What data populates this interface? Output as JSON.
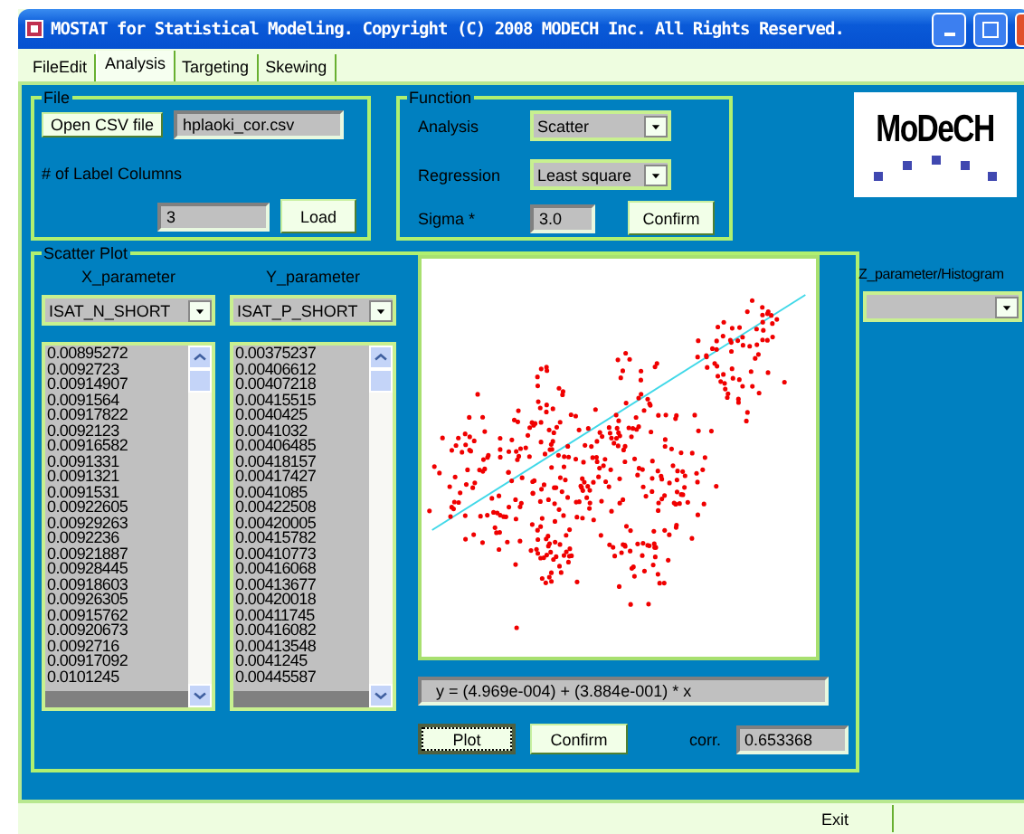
{
  "window": {
    "title": "MOSTAT for Statistical Modeling. Copyright (C) 2008 MODECH Inc. All Rights Reserved."
  },
  "tabs": [
    {
      "label": "FileEdit",
      "selected": false
    },
    {
      "label": "Analysis",
      "selected": true
    },
    {
      "label": "Targeting",
      "selected": false
    },
    {
      "label": "Skewing",
      "selected": false
    }
  ],
  "file": {
    "legend": "File",
    "open_button": "Open CSV file",
    "filename": "hplaoki_cor.csv",
    "label_columns_label": "# of Label Columns",
    "label_columns": "3",
    "load_button": "Load"
  },
  "function": {
    "legend": "Function",
    "rows": [
      {
        "label": "Analysis",
        "value": "Scatter"
      },
      {
        "label": "Regression",
        "value": "Least square"
      }
    ],
    "sigma_label": "Sigma *",
    "sigma": "3.0",
    "confirm_button": "Confirm"
  },
  "logo": {
    "text": "MoDeCH"
  },
  "scatter": {
    "legend": "Scatter Plot",
    "x_label": "X_parameter",
    "x_value": "ISAT_N_SHORT",
    "x_list": [
      "0.00895272",
      "0.0092723",
      "0.00914907",
      "0.0091564",
      "0.00917822",
      "0.0092123",
      "0.00916582",
      "0.0091331",
      "0.0091321",
      "0.0091531",
      "0.00922605",
      "0.00929263",
      "0.0092236",
      "0.00921887",
      "0.00928445",
      "0.00918603",
      "0.00926305",
      "0.00915762",
      "0.00920673",
      "0.0092716",
      "0.00917092",
      "0.0101245"
    ],
    "y_label": "Y_parameter",
    "y_value": "ISAT_P_SHORT",
    "y_list": [
      "0.00375237",
      "0.00406612",
      "0.00407218",
      "0.00415515",
      "0.0040425",
      "0.0041032",
      "0.00406485",
      "0.00418157",
      "0.00417427",
      "0.0041085",
      "0.00422508",
      "0.00420005",
      "0.00415782",
      "0.00410773",
      "0.00416068",
      "0.00413677",
      "0.00420018",
      "0.00411745",
      "0.00416082",
      "0.00413548",
      "0.0041245",
      "0.00445587"
    ],
    "equation": "y = (4.969e-004) + (3.884e-001) * x",
    "plot_button": "Plot",
    "confirm_button": "Confirm",
    "corr_label": "corr.",
    "corr": "0.653368"
  },
  "z": {
    "label": "Z_parameter/Histogram"
  },
  "exit_button": "Exit"
}
